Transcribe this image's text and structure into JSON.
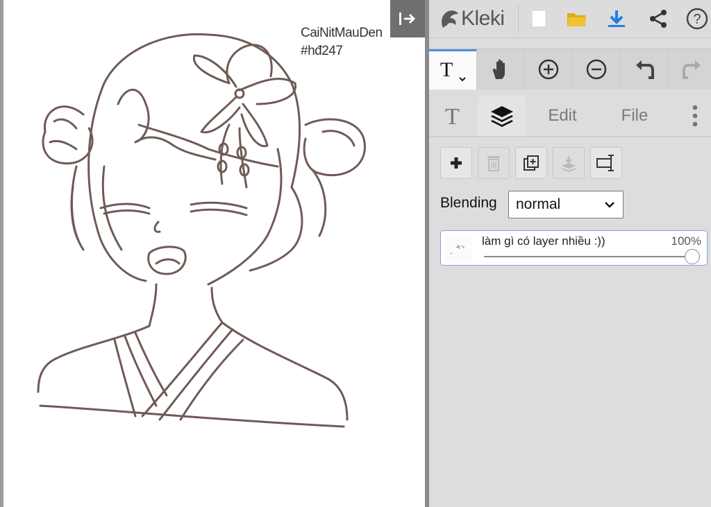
{
  "canvas": {
    "signature_line1": "CaiNitMauDen",
    "signature_line2": "#hđ247"
  },
  "collapse_button": {
    "icon": "collapse-panel-icon"
  },
  "app": {
    "name": "Kleki"
  },
  "topbar": {
    "icons": [
      "new-image-icon",
      "open-folder-icon",
      "download-icon",
      "share-icon",
      "help-icon"
    ]
  },
  "toolbar": {
    "active_tool": "text",
    "tools": [
      "text-tool-icon",
      "hand-icon",
      "zoom-in-icon",
      "zoom-out-icon",
      "undo-icon",
      "redo-icon"
    ]
  },
  "tabs": {
    "edit_label": "Edit",
    "file_label": "File"
  },
  "layers": {
    "blending_label": "Blending",
    "blending_value": "normal",
    "items": [
      {
        "name": "làm gì có layer nhiều :))",
        "opacity_label": "100%",
        "opacity": 1.0
      }
    ]
  },
  "colors": {
    "line_art": "#6f5a55",
    "accent_blue": "#4a8fd6",
    "download_blue": "#1f7fe0",
    "folder_yellow": "#f2c232"
  }
}
